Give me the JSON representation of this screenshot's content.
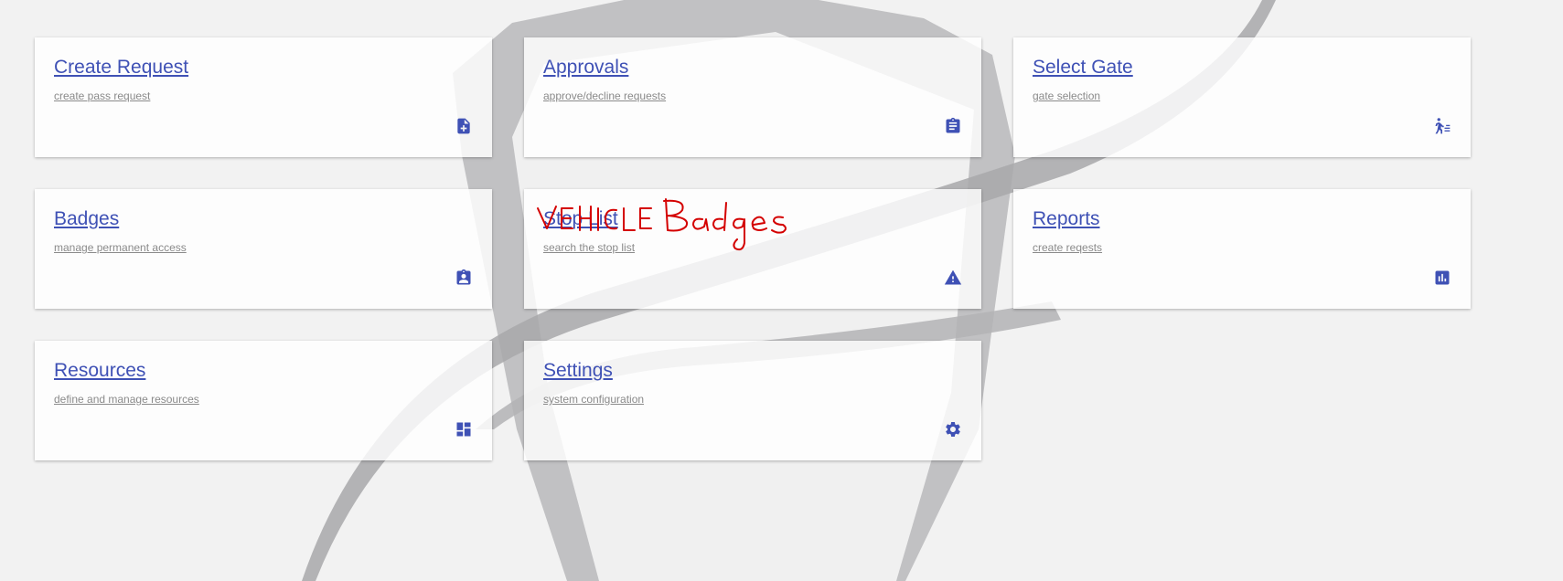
{
  "cards": [
    {
      "title": "Create Request",
      "subtitle": "create pass request",
      "icon": "file-plus-icon"
    },
    {
      "title": "Approvals",
      "subtitle": "approve/decline requests",
      "icon": "clipboard-icon"
    },
    {
      "title": "Select Gate",
      "subtitle": "gate selection",
      "icon": "person-walking-gate-icon"
    },
    {
      "title": "Badges",
      "subtitle": "manage permanent access",
      "icon": "badge-icon"
    },
    {
      "title": "Stop List",
      "subtitle": "search the stop list",
      "icon": "warning-icon"
    },
    {
      "title": "Reports",
      "subtitle": "create reqests",
      "icon": "bar-chart-icon"
    },
    {
      "title": "Resources",
      "subtitle": "define and manage resources",
      "icon": "dashboard-icon"
    },
    {
      "title": "Settings",
      "subtitle": "system configuration",
      "icon": "gear-icon"
    }
  ],
  "annotation": {
    "text": "VEHICLE Badges",
    "color": "#d40000"
  },
  "colors": {
    "accent": "#3f51b5",
    "background": "#f2f2f2",
    "subtitle": "#8a8a8a"
  }
}
